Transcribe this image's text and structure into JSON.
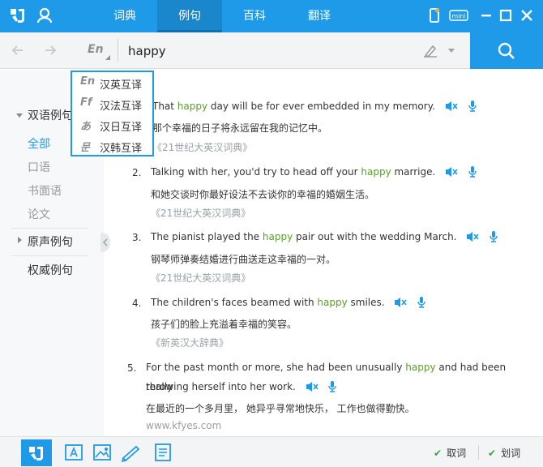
{
  "tabs": [
    "词典",
    "例句",
    "百科",
    "翻译"
  ],
  "search": {
    "lang": "En",
    "value": "happy"
  },
  "sidebar": {
    "section1": "双语例句",
    "subitems": [
      "全部",
      "口语",
      "书面语",
      "论文"
    ],
    "section2": "原声例句",
    "section3": "权威例句"
  },
  "dropdown": [
    {
      "icon": "En",
      "label": "汉英互译"
    },
    {
      "icon": "Ff",
      "label": "汉法互译"
    },
    {
      "icon": "あ",
      "label": "汉日互译"
    },
    {
      "icon": "문",
      "label": "汉韩互译"
    }
  ],
  "sentences": [
    {
      "num": "",
      "en_pre": "That ",
      "hl": "happy",
      "en_post": " day will be for ever embedded in my memory.",
      "cn": "那个幸福的日子将永远留在我的记忆中。",
      "src": "《21世纪大英汉词典》"
    },
    {
      "num": "2.",
      "en_pre": "Talking with her, you'd try to head off your ",
      "hl": "happy",
      "en_post": " marrige.",
      "cn": "和她交谈时你最好设法不去谈你的幸福的婚姻生活。",
      "src": "《21世纪大英汉词典》"
    },
    {
      "num": "3.",
      "en_pre": "The pianist played the ",
      "hl": "happy",
      "en_post": " pair out with the wedding March.",
      "cn": "钢琴师弹奏结婚进行曲送走这幸福的一对。",
      "src": "《21世纪大英汉词典》"
    },
    {
      "num": "4.",
      "en_pre": "The children's faces beamed with ",
      "hl": "happy",
      "en_post": " smiles.",
      "cn": "孩子们的脸上充溢着幸福的笑容。",
      "src": "《新英汉大辞典》"
    },
    {
      "num": "5.",
      "en_pre": "For the past month or more, she had been unusually ",
      "hl": "happy",
      "en_post": " and had been really",
      "en_line2": "throwing herself into her work.",
      "cn": "在最近的一个多月里， 她异乎寻常地快乐， 工作也做得勤快。",
      "src": "www.kfyes.com"
    }
  ],
  "bottom": {
    "quci": "取词",
    "huaci": "划词"
  },
  "mini_label": "mini",
  "colors": {
    "accent": "#1e9ae9",
    "highlight": "#5a9e2a"
  }
}
